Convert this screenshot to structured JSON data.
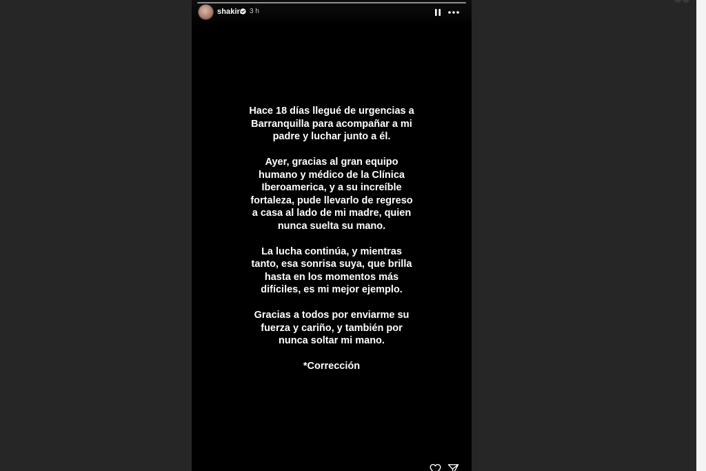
{
  "story": {
    "username": "shakira",
    "timestamp": "3 h",
    "paragraphs": [
      "Hace 18 días llegué de urgencias a\nBarranquilla para acompañar a mi\npadre y luchar junto a él.",
      "Ayer, gracias al gran equipo\nhumano y médico de la Clínica\nIberoamerica, y a su increíble\nfortaleza, pude llevarlo de regreso\na casa al lado de mi madre, quien\nnunca suelta su mano.",
      "La lucha continúa, y mientras\ntanto, esa sonrisa suya, que brilla\nhasta en los momentos más\ndifíciles, es mi mejor ejemplo.",
      "Gracias a todos por enviarme su\nfuerza y cariño, y también por\nnunca soltar mi mano.",
      "*Corrección"
    ]
  },
  "icons": {
    "verified": "verified-badge-icon",
    "pause": "pause-icon",
    "more": "more-options-icon",
    "like": "heart-icon",
    "share": "paper-plane-icon"
  },
  "colors": {
    "backdrop": "#262626",
    "story_background": "#000000",
    "text": "#ffffff"
  }
}
